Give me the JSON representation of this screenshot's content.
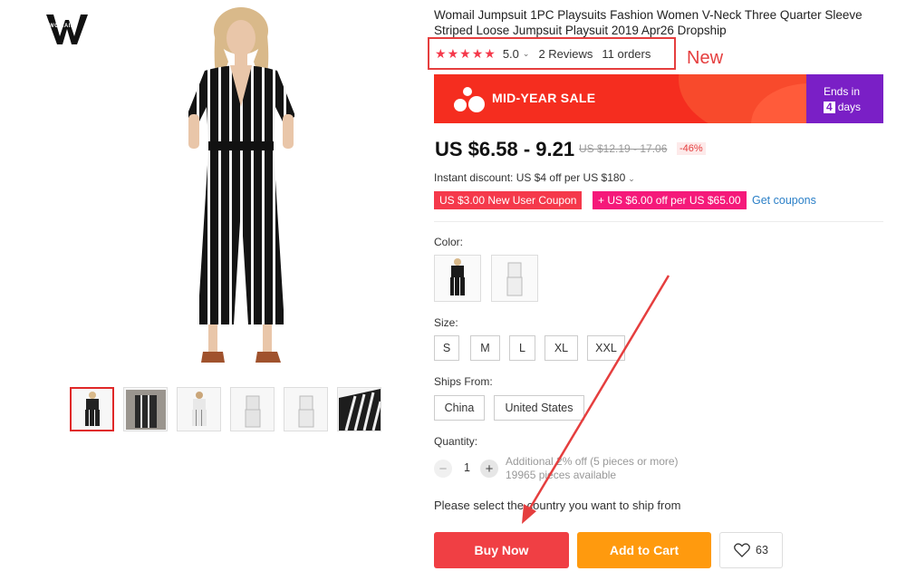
{
  "brand": {
    "logo_letters": "W",
    "logo_text": "WOMAIL"
  },
  "product": {
    "title": "Womail Jumpsuit 1PC Playsuits Fashion Women V-Neck Three Quarter Sleeve Striped Loose Jumpsuit Playsuit 2019 Apr26 Dropship",
    "rating": "5.0",
    "rating_stars": 5,
    "reviews": "2 Reviews",
    "orders": "11 orders"
  },
  "annotation": {
    "new_label": "New",
    "highlight_color": "#e53e3e"
  },
  "sale": {
    "title": "MID-YEAR SALE",
    "ends_label": "Ends in",
    "ends_number": "4",
    "ends_unit": "days"
  },
  "price": {
    "current": "US $6.58 - 9.21",
    "original": "US $12.19 - 17.06",
    "discount": "-46%"
  },
  "instant_discount": "Instant discount: US $4 off per US $180",
  "coupons": {
    "new_user": "US $3.00 New User Coupon",
    "store": "+ US $6.00 off per US $65.00",
    "get_link": "Get coupons"
  },
  "options": {
    "color_label": "Color:",
    "size_label": "Size:",
    "sizes": [
      "S",
      "M",
      "L",
      "XL",
      "XXL"
    ],
    "ships_label": "Ships From:",
    "ships_from": [
      "China",
      "United States"
    ]
  },
  "quantity": {
    "label": "Quantity:",
    "value": "1",
    "minus": "−",
    "plus": "+",
    "bulk_note": "Additional 2% off (5 pieces or more)",
    "available": "19965 pieces available"
  },
  "ship_message": "Please select the country you want to ship from",
  "actions": {
    "buy_now": "Buy Now",
    "add_to_cart": "Add to Cart",
    "wishlist_count": "63"
  },
  "colors": {
    "accent": "#f03f44",
    "cart": "#ff9a0e",
    "sale_banner": "#f52d1f",
    "ends_in_bg": "#7a1fc6",
    "link": "#2a7fc7"
  }
}
